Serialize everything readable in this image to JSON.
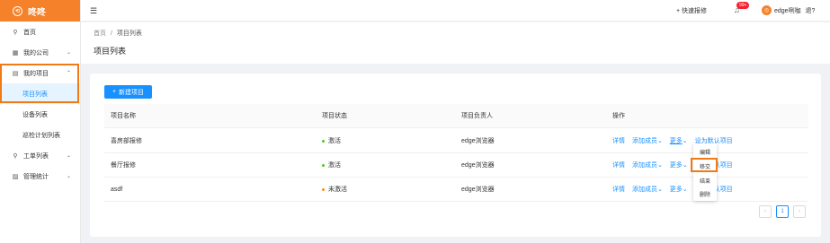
{
  "sidebar": {
    "logo": "咚咚",
    "items": [
      {
        "label": "首页",
        "icon": "user-icon"
      },
      {
        "label": "我的公司",
        "icon": "building-icon"
      },
      {
        "label": "我的项目",
        "icon": "project-icon"
      },
      {
        "label": "项目列表"
      },
      {
        "label": "设备列表"
      },
      {
        "label": "巡检计划列表"
      },
      {
        "label": "工单列表",
        "icon": "user-icon"
      },
      {
        "label": "管理统计",
        "icon": "chart-icon"
      }
    ]
  },
  "topbar": {
    "quick_repair": "+ 快速报修",
    "badge": "99+",
    "username": "edge咧咖",
    "logout": "退?"
  },
  "header": {
    "crumb_home": "首页",
    "crumb_sep": "/",
    "crumb_current": "项目列表",
    "title": "项目列表"
  },
  "toolbar": {
    "new_label": "新建项目"
  },
  "table": {
    "headers": [
      "项目名称",
      "项目状态",
      "项目负责人",
      "操作"
    ],
    "rows": [
      {
        "name": "喜房部报修",
        "status": "激活",
        "owner": "edge浏览器",
        "status_color": "#52c41a"
      },
      {
        "name": "餐厅报修",
        "status": "激活",
        "owner": "edge浏览器",
        "status_color": "#52c41a"
      },
      {
        "name": "asdf",
        "status": "未激活",
        "owner": "edge浏览器",
        "status_color": "#fa8c16"
      }
    ],
    "actions": {
      "detail": "详情",
      "add_member": "添加成员",
      "more": "更多",
      "set_default": "设为默认项目"
    }
  },
  "dropdown": [
    "编辑",
    "移交",
    "结束",
    "删除"
  ],
  "pagination": {
    "current": "1"
  },
  "colors": {
    "accent": "#1890ff",
    "brand": "#f5822a",
    "highlight": "#f07b14"
  }
}
